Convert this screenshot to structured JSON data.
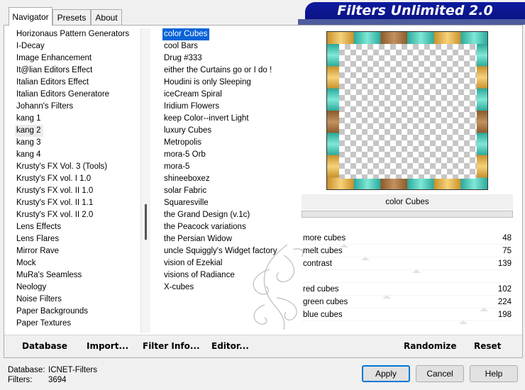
{
  "tabs": [
    {
      "label": "Navigator",
      "active": true
    },
    {
      "label": "Presets",
      "active": false
    },
    {
      "label": "About",
      "active": false
    }
  ],
  "title": "Filters Unlimited 2.0",
  "categories": [
    "Horizonaus Pattern Generators",
    "I-Decay",
    "Image Enhancement",
    "It@lian Editors Effect",
    "Italian Editors Effect",
    "Italian Editors Generatore",
    "Johann's Filters",
    "kang 1",
    "kang 2",
    "kang 3",
    "kang 4",
    "Krusty's FX Vol. 3 (Tools)",
    "Krusty's FX vol. I 1.0",
    "Krusty's FX vol. II 1.0",
    "Krusty's FX vol. II 1.1",
    "Krusty's FX vol. II 2.0",
    "Lens Effects",
    "Lens Flares",
    "Mirror Rave",
    "Mock",
    "MuRa's Seamless",
    "Neology",
    "Noise Filters",
    "Paper Backgrounds",
    "Paper Textures"
  ],
  "selected_category": "kang 2",
  "filters": [
    "color Cubes",
    "cool Bars",
    "Drug #333",
    "either the Curtains go or I do !",
    "Houdini is only Sleeping",
    "iceCream Spiral",
    "Iridium Flowers",
    "keep Color--invert Light",
    "luxury Cubes",
    "Metropolis",
    "mora-5 Orb",
    "mora-5",
    "shineeboxez",
    "solar Fabric",
    "Squaresville",
    "the Grand Design     (v.1c)",
    "the Peacock variations",
    "the Persian Widow",
    "uncle Squiggly's Widget factory",
    "vision of Ezekial",
    "visions of Radiance",
    "X-cubes"
  ],
  "selected_filter": "color Cubes",
  "preview_filter_name": "color Cubes",
  "frame_colors": {
    "teal": "#2aa89a",
    "gold": "#c8902a",
    "brown": "#8a5a2a"
  },
  "params": [
    {
      "label": "more cubes",
      "value": "48",
      "max": 255
    },
    {
      "label": "melt cubes",
      "value": "75",
      "max": 255
    },
    {
      "label": "contrast",
      "value": "139",
      "max": 255
    },
    {
      "label": "",
      "value": "",
      "max": 255
    },
    {
      "label": "red cubes",
      "value": "102",
      "max": 255
    },
    {
      "label": "green cubes",
      "value": "224",
      "max": 255
    },
    {
      "label": "blue cubes",
      "value": "198",
      "max": 255
    }
  ],
  "toolbar": {
    "database": "Database",
    "import": "Import...",
    "filter_info": "Filter Info...",
    "editor": "Editor...",
    "randomize": "Randomize",
    "reset": "Reset"
  },
  "status": {
    "database_label": "Database:",
    "database_value": "ICNET-Filters",
    "filters_label": "Filters:",
    "filters_value": "3694"
  },
  "buttons": {
    "apply": "Apply",
    "cancel": "Cancel",
    "help": "Help"
  }
}
